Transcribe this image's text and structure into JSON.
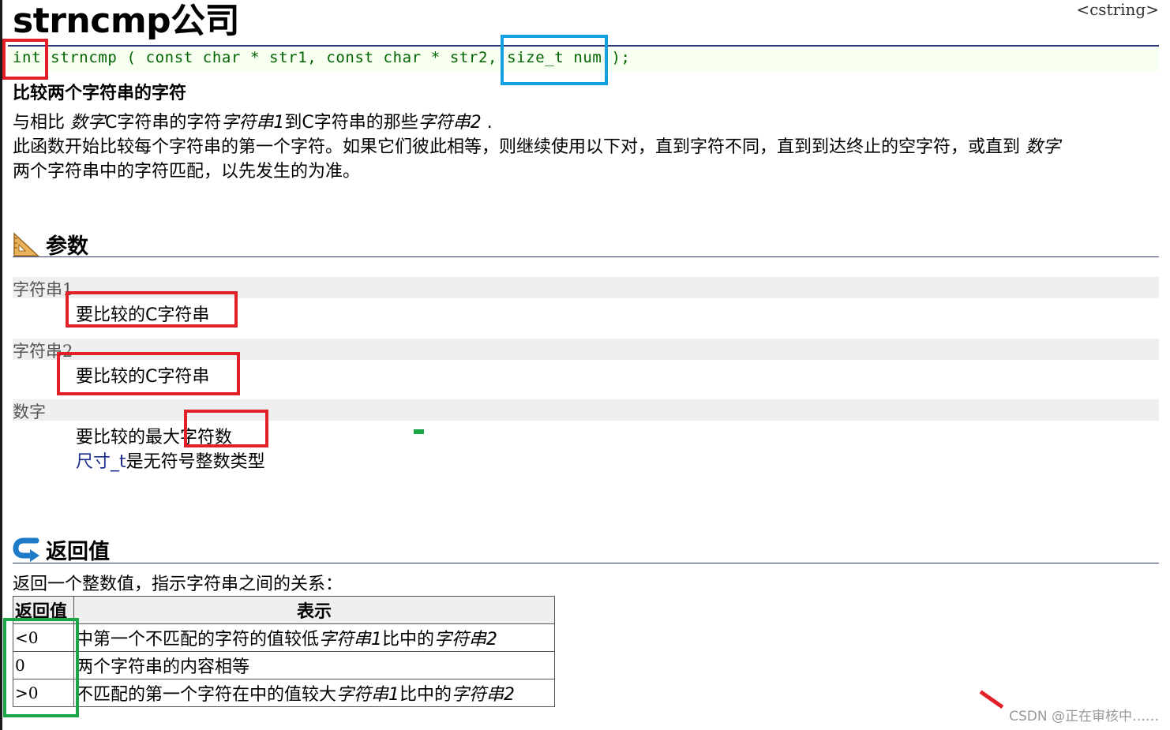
{
  "header": {
    "title": "strncmp公司",
    "tag": "<cstring>"
  },
  "prototype": {
    "ret_type": "int",
    "fn_name": "strncmp",
    "open": " ( ",
    "param1": "const char * str1, ",
    "param2": "const char * str2, ",
    "param3": "size_t num",
    "close": " );"
  },
  "subtitle": "比较两个字符串的字符",
  "description": {
    "l1_a": "与相比 ",
    "l1_b": "数字",
    "l1_c": "C字符串的字符",
    "l1_d": "字符串1",
    "l1_e": "到C字符串的那些",
    "l1_f": "字符串2",
    "l1_g": " .",
    "l2_a": "此函数开始比较每个字符串的第一个字符。如果它们彼此相等，则继续使用以下对，直到字符不同，直到到达终止的空字符，或直到 ",
    "l2_b": "数字",
    "l3": "两个字符串中的字符匹配，以先发生的为准。"
  },
  "params_section": {
    "heading": "参数",
    "items": [
      {
        "name": "字符串1",
        "desc": "要比较的C字符串"
      },
      {
        "name": "字符串2",
        "desc": "要比较的C字符串"
      },
      {
        "name": "数字",
        "desc": "要比较的最大字符数",
        "desc2": "尺寸_t",
        "desc3": "是无符号整数类型"
      }
    ]
  },
  "return_section": {
    "heading": "返回值",
    "intro": "返回一个整数值，指示字符串之间的关系：",
    "col1": "返回值",
    "col2": "表示",
    "rows": [
      {
        "value": "<0",
        "m_a": "中第一个不匹配的字符的值较低",
        "m_b": "字符串1",
        "m_c": "比中的",
        "m_d": "字符串2"
      },
      {
        "value": "0",
        "m_a": "两个字符串的内容相等",
        "m_b": "",
        "m_c": "",
        "m_d": ""
      },
      {
        "value": ">0",
        "m_a": "不匹配的第一个字符在中的值较大",
        "m_b": "字符串1",
        "m_c": "比中的",
        "m_d": "字符串2"
      }
    ]
  },
  "watermark": "CSDN @正在审核中……",
  "colors": {
    "highlight_red": "#e3202a",
    "highlight_blue": "#14a0e0",
    "highlight_green": "#1aa547",
    "code_green": "#006400",
    "rule_navy": "#2c3a7c"
  }
}
